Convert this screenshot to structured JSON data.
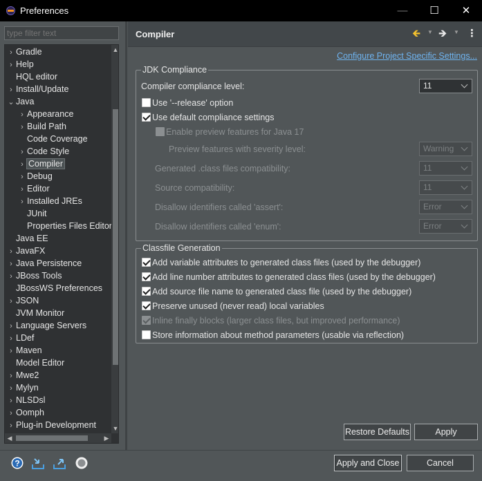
{
  "window": {
    "title": "Preferences",
    "minimize": "—",
    "maximize": "☐",
    "close": "✕"
  },
  "filter": {
    "placeholder": "type filter text"
  },
  "tree": {
    "items": [
      {
        "label": "Gradle",
        "expander": "›"
      },
      {
        "label": "Help",
        "expander": "›"
      },
      {
        "label": "HQL editor",
        "expander": ""
      },
      {
        "label": "Install/Update",
        "expander": "›"
      },
      {
        "label": "Java",
        "expander": "⌄"
      },
      {
        "label": "Appearance",
        "expander": "›"
      },
      {
        "label": "Build Path",
        "expander": "›"
      },
      {
        "label": "Code Coverage",
        "expander": ""
      },
      {
        "label": "Code Style",
        "expander": "›"
      },
      {
        "label": "Compiler",
        "expander": "›"
      },
      {
        "label": "Debug",
        "expander": "›"
      },
      {
        "label": "Editor",
        "expander": "›"
      },
      {
        "label": "Installed JREs",
        "expander": "›"
      },
      {
        "label": "JUnit",
        "expander": ""
      },
      {
        "label": "Properties Files Editor",
        "expander": ""
      },
      {
        "label": "Java EE",
        "expander": ""
      },
      {
        "label": "JavaFX",
        "expander": "›"
      },
      {
        "label": "Java Persistence",
        "expander": "›"
      },
      {
        "label": "JBoss Tools",
        "expander": "›"
      },
      {
        "label": "JBossWS Preferences",
        "expander": ""
      },
      {
        "label": "JSON",
        "expander": "›"
      },
      {
        "label": "JVM Monitor",
        "expander": ""
      },
      {
        "label": "Language Servers",
        "expander": "›"
      },
      {
        "label": "LDef",
        "expander": "›"
      },
      {
        "label": "Maven",
        "expander": "›"
      },
      {
        "label": "Model Editor",
        "expander": ""
      },
      {
        "label": "Mwe2",
        "expander": "›"
      },
      {
        "label": "Mylyn",
        "expander": "›"
      },
      {
        "label": "NLSDsl",
        "expander": "›"
      },
      {
        "label": "Oomph",
        "expander": "›"
      },
      {
        "label": "Plug-in Development",
        "expander": "›"
      }
    ],
    "selected": "Compiler"
  },
  "page": {
    "title": "Compiler",
    "configure_link": "Configure Project Specific Settings..."
  },
  "jdk": {
    "group_title": "JDK Compliance",
    "compliance_label": "Compiler compliance level:",
    "compliance_value": "11",
    "use_release": "Use '--release' option",
    "use_default": "Use default compliance settings",
    "enable_preview": "Enable preview features for Java 17",
    "preview_severity_label": "Preview features with severity level:",
    "preview_severity_value": "Warning",
    "generated_label": "Generated .class files compatibility:",
    "generated_value": "11",
    "source_label": "Source compatibility:",
    "source_value": "11",
    "assert_label": "Disallow identifiers called 'assert':",
    "assert_value": "Error",
    "enum_label": "Disallow identifiers called 'enum':",
    "enum_value": "Error"
  },
  "classfile": {
    "group_title": "Classfile Generation",
    "items": [
      "Add variable attributes to generated class files (used by the debugger)",
      "Add line number attributes to generated class files (used by the debugger)",
      "Add source file name to generated class file (used by the debugger)",
      "Preserve unused (never read) local variables",
      "Inline finally blocks (larger class files, but improved performance)",
      "Store information about method parameters (usable via reflection)"
    ]
  },
  "buttons": {
    "restore_defaults": "Restore Defaults",
    "apply": "Apply",
    "apply_and_close": "Apply and Close",
    "cancel": "Cancel"
  },
  "colors": {
    "background": "#515658",
    "tree_background": "#2f3133",
    "link": "#6fb4f0",
    "back_arrow": "#f2c12e"
  }
}
